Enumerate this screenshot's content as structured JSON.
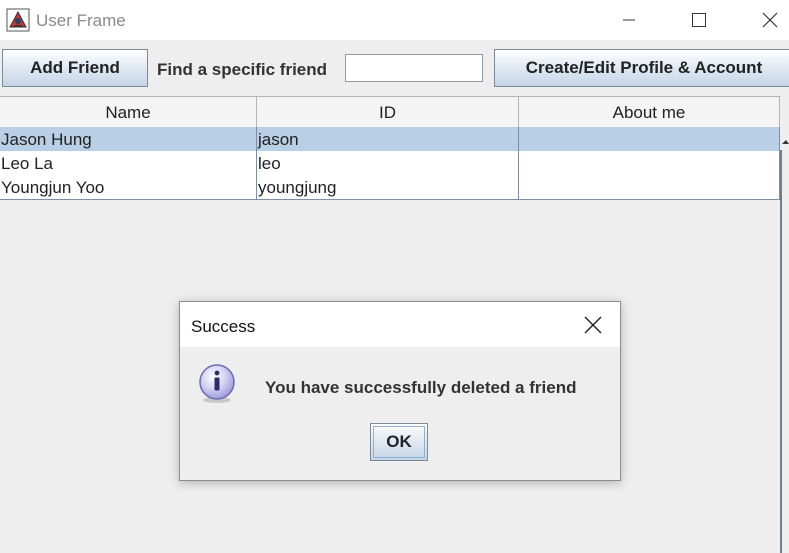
{
  "window": {
    "title": "User Frame"
  },
  "toolbar": {
    "add_friend_label": "Add Friend",
    "find_label": "Find a specific friend",
    "find_value": "",
    "profile_label": "Create/Edit Profile & Account"
  },
  "table": {
    "columns": [
      "Name",
      "ID",
      "About me"
    ],
    "rows": [
      {
        "name": "Jason Hung",
        "id": "jason",
        "about": ""
      },
      {
        "name": "Leo La",
        "id": "leo",
        "about": ""
      },
      {
        "name": "Youngjun Yoo",
        "id": "youngjung",
        "about": ""
      }
    ],
    "selected_row": 0
  },
  "dialog": {
    "title": "Success",
    "message": "You have successfully deleted a friend",
    "ok_label": "OK",
    "icon": "info-icon"
  },
  "colors": {
    "selection": "#b8cfe5",
    "button_gradient_bottom": "#c5d6e8",
    "background": "#eeeeee"
  }
}
